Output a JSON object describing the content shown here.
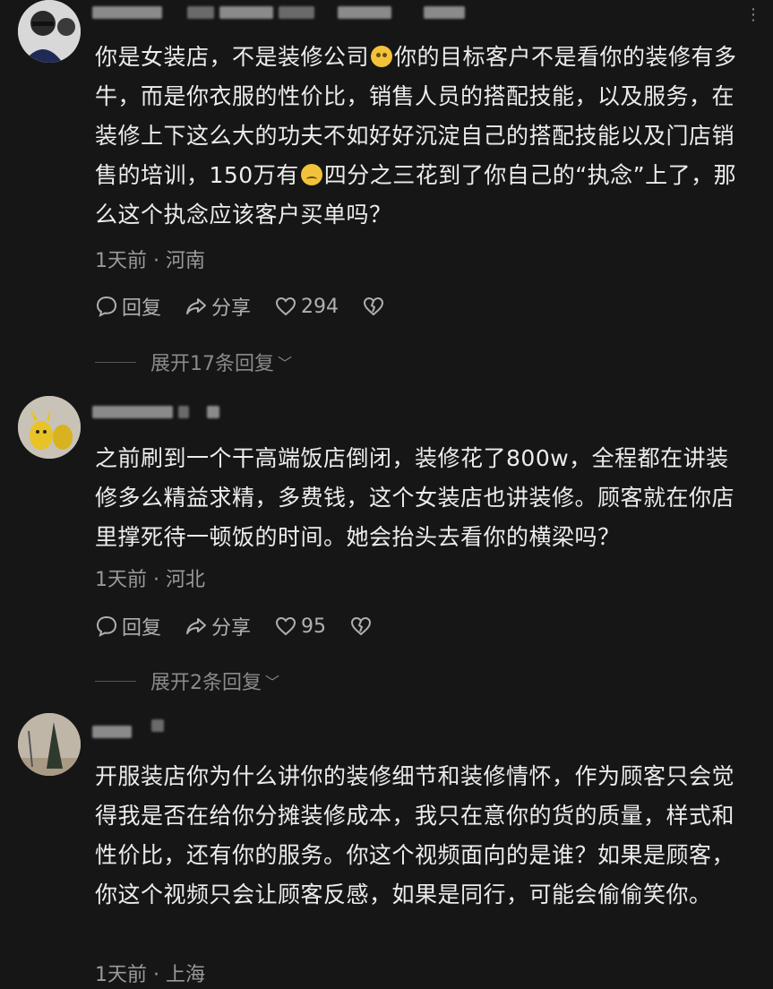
{
  "comments": [
    {
      "text_a": "你是女装店，不是装修公司",
      "emoji_a": "crying-emoji",
      "text_b": "你的目标客户不是看你的装修有多牛，而是你衣服的性价比，销售人员的搭配技能，以及服务，在装修上下这么大的功夫不如好好沉淀自己的搭配技能以及门店销售的培训，150万有",
      "emoji_b": "sad-emoji",
      "text_c": "四分之三花到了你自己的“执念”上了，那么这个执念应该客户买单吗？",
      "meta": "1天前 · 河南",
      "reply_label": "回复",
      "share_label": "分享",
      "likes": "294",
      "expand_label": "展开17条回复"
    },
    {
      "text": "之前刷到一个干高端饭店倒闭，装修花了800w，全程都在讲装修多么精益求精，多费钱，这个女装店也讲装修。顾客就在你店里撑死待一顿饭的时间。她会抬头去看你的横梁吗？",
      "meta": "1天前 · 河北",
      "reply_label": "回复",
      "share_label": "分享",
      "likes": "95",
      "expand_label": "展开2条回复"
    },
    {
      "text": "开服装店你为什么讲你的装修细节和装修情怀，作为顾客只会觉得我是否在给你分摊装修成本，我只在意你的货的质量，样式和性价比，还有你的服务。你这个视频面向的是谁？如果是顾客，你这个视频只会让顾客反感，如果是同行，可能会偷偷笑你。",
      "meta": "1天前 · 上海"
    }
  ],
  "icons": {
    "reply": "comment-bubble-icon",
    "share": "share-arrow-icon",
    "like": "heart-icon",
    "dislike": "broken-heart-icon",
    "more": "more-dots-icon",
    "expand": "chevron-down-icon"
  }
}
